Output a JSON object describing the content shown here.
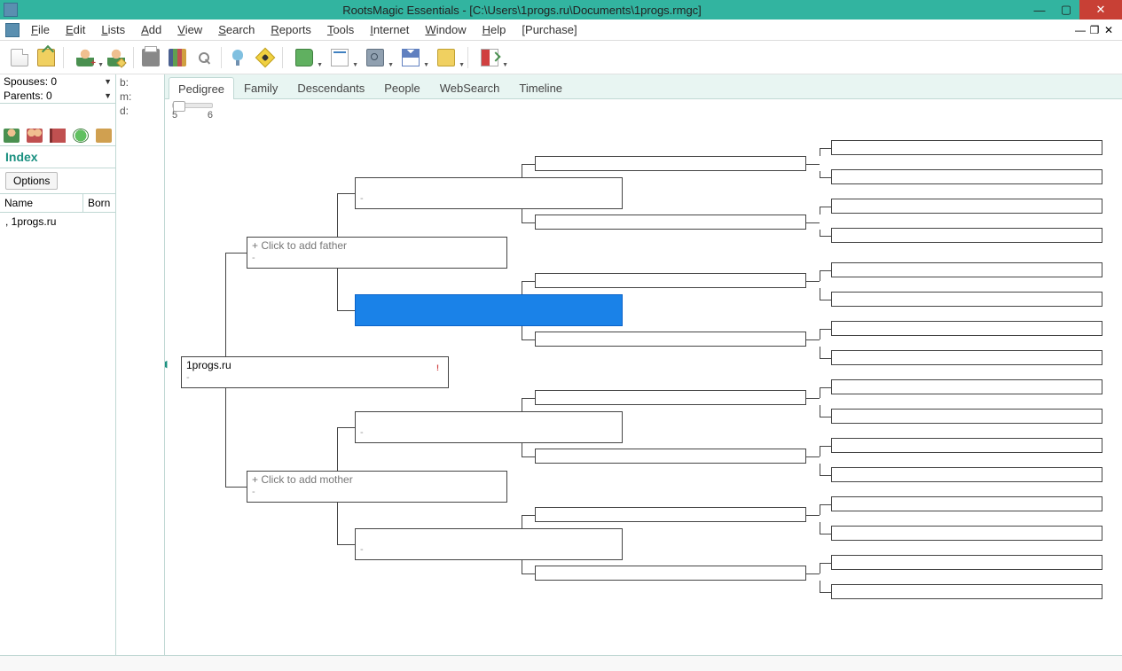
{
  "titlebar": {
    "title": "RootsMagic Essentials - [C:\\Users\\1progs.ru\\Documents\\1progs.rmgc]"
  },
  "menu": {
    "file": "File",
    "edit": "Edit",
    "lists": "Lists",
    "add": "Add",
    "view": "View",
    "search": "Search",
    "reports": "Reports",
    "tools": "Tools",
    "internet": "Internet",
    "window": "Window",
    "help": "Help",
    "purchase": "[Purchase]"
  },
  "left": {
    "spouses": "Spouses: 0",
    "parents": "Parents: 0",
    "detail_b": "b:",
    "detail_m": "m:",
    "detail_d": "d:",
    "index_title": "Index",
    "options_btn": "Options",
    "col_name": "Name",
    "col_born": "Born",
    "rows": [
      ", 1progs.ru"
    ]
  },
  "tabs": {
    "items": [
      "Pedigree",
      "Family",
      "Descendants",
      "People",
      "WebSearch",
      "Timeline"
    ],
    "active": 0,
    "slider_min": "5",
    "slider_max": "6"
  },
  "pedigree": {
    "root_name": "1progs.ru",
    "root_sub": "-",
    "add_father": "+  Click to add father",
    "add_father_sub": "-",
    "add_mother": "+  Click to add mother",
    "add_mother_sub": "-",
    "blank_sub": "-"
  }
}
